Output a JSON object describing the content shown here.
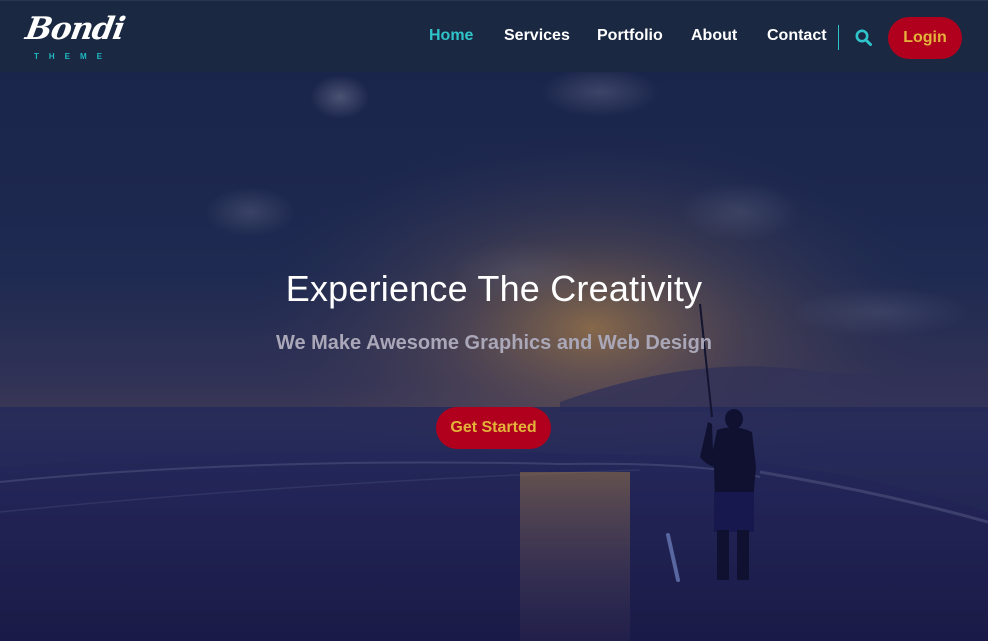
{
  "brand": {
    "name": "Bondi",
    "tagline": "THEME"
  },
  "nav": {
    "items": [
      {
        "label": "Home",
        "active": true
      },
      {
        "label": "Services",
        "active": false
      },
      {
        "label": "Portfolio",
        "active": false
      },
      {
        "label": "About",
        "active": false
      },
      {
        "label": "Contact",
        "active": false
      }
    ],
    "search_icon": "search-icon",
    "login_label": "Login"
  },
  "hero": {
    "title": "Experience The Creativity",
    "subtitle": "We Make Awesome Graphics and Web Design",
    "cta_label": "Get Started",
    "background": "dusk beach scene with silhouette of a man fishing"
  },
  "colors": {
    "header_bg": "#1b2842",
    "accent_teal": "#2fc4c9",
    "button_red": "#b0001e",
    "button_text_gold": "#e4b33a"
  }
}
